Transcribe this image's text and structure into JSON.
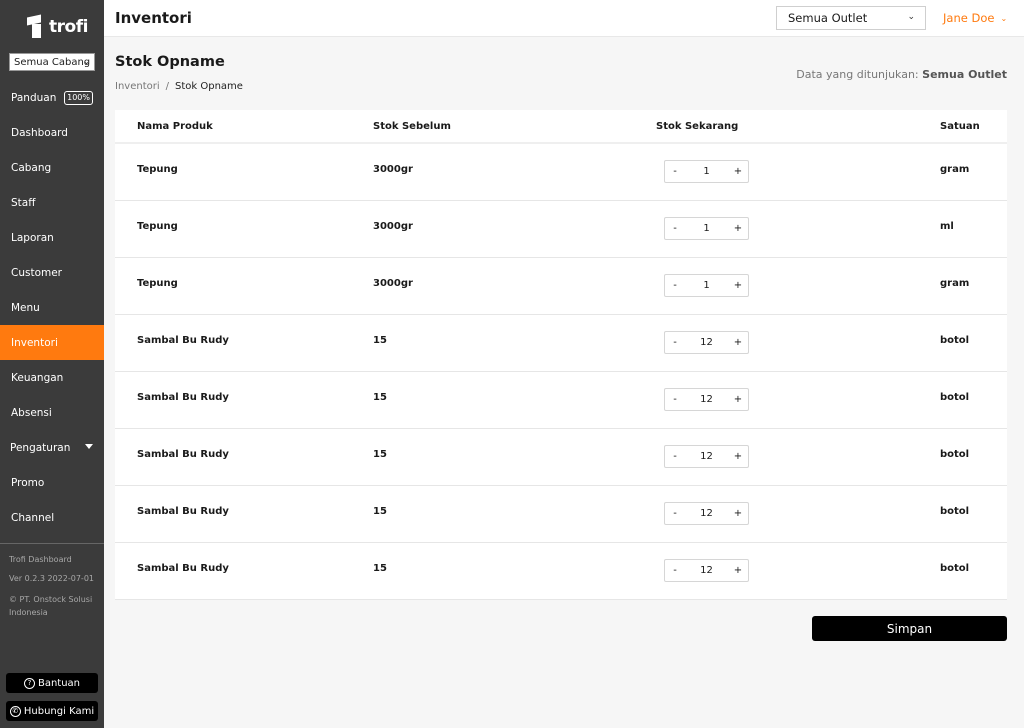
{
  "brand": {
    "name": "trofi"
  },
  "sidebar": {
    "branch_select": "Semua Cabang",
    "items": [
      {
        "label": "Panduan",
        "badge": "100%"
      },
      {
        "label": "Dashboard"
      },
      {
        "label": "Cabang"
      },
      {
        "label": "Staff"
      },
      {
        "label": "Laporan"
      },
      {
        "label": "Customer"
      },
      {
        "label": "Menu"
      },
      {
        "label": "Inventori",
        "active": true
      },
      {
        "label": "Keuangan"
      },
      {
        "label": "Absensi"
      },
      {
        "label": "Pengaturan"
      },
      {
        "label": "Promo"
      },
      {
        "label": "Channel"
      }
    ],
    "footer": {
      "app_name": "Trofi Dashboard",
      "version": "Ver 0.2.3 2022-07-01",
      "company": "© PT. Onstock Solusi Indonesia"
    },
    "help_label": "Bantuan",
    "contact_label": "Hubungi Kami"
  },
  "header": {
    "title": "Inventori",
    "outlet_select": "Semua Outlet",
    "user_name": "Jane Doe"
  },
  "page": {
    "title": "Stok Opname",
    "breadcrumb": [
      "Inventori",
      "/",
      "Stok Opname"
    ],
    "shown_label": "Data yang ditunjukan:",
    "shown_value": "Semua Outlet"
  },
  "table": {
    "columns": [
      "Nama Produk",
      "Stok Sebelum",
      "Stok Sekarang",
      "Satuan"
    ],
    "rows": [
      {
        "product": "Tepung",
        "before": "3000gr",
        "current": "1",
        "unit": "gram"
      },
      {
        "product": "Tepung",
        "before": "3000gr",
        "current": "1",
        "unit": "ml"
      },
      {
        "product": "Tepung",
        "before": "3000gr",
        "current": "1",
        "unit": "gram"
      },
      {
        "product": "Sambal Bu Rudy",
        "before": "15",
        "current": "12",
        "unit": "botol"
      },
      {
        "product": "Sambal Bu Rudy",
        "before": "15",
        "current": "12",
        "unit": "botol"
      },
      {
        "product": "Sambal Bu Rudy",
        "before": "15",
        "current": "12",
        "unit": "botol"
      },
      {
        "product": "Sambal Bu Rudy",
        "before": "15",
        "current": "12",
        "unit": "botol"
      },
      {
        "product": "Sambal Bu Rudy",
        "before": "15",
        "current": "12",
        "unit": "botol"
      }
    ],
    "minus_label": "-",
    "plus_label": "+"
  },
  "actions": {
    "save_label": "Simpan"
  },
  "colors": {
    "accent": "#ff7a0f",
    "sidebar_bg": "#3b3b3b"
  }
}
